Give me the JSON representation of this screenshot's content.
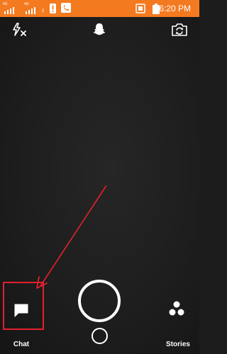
{
  "status_bar": {
    "network_label_1": "4G",
    "network_label_2": "4G",
    "sim2_label": "2",
    "time": "6:20 PM",
    "bg_color": "#f47a20"
  },
  "camera": {
    "flash_icon": "flash-off-icon",
    "ghost_icon": "snapchat-ghost-icon",
    "flip_icon": "flip-camera-icon"
  },
  "bottom_nav": {
    "chat_label": "Chat",
    "stories_label": "Stories"
  },
  "annotation": {
    "color": "#e3212b"
  }
}
